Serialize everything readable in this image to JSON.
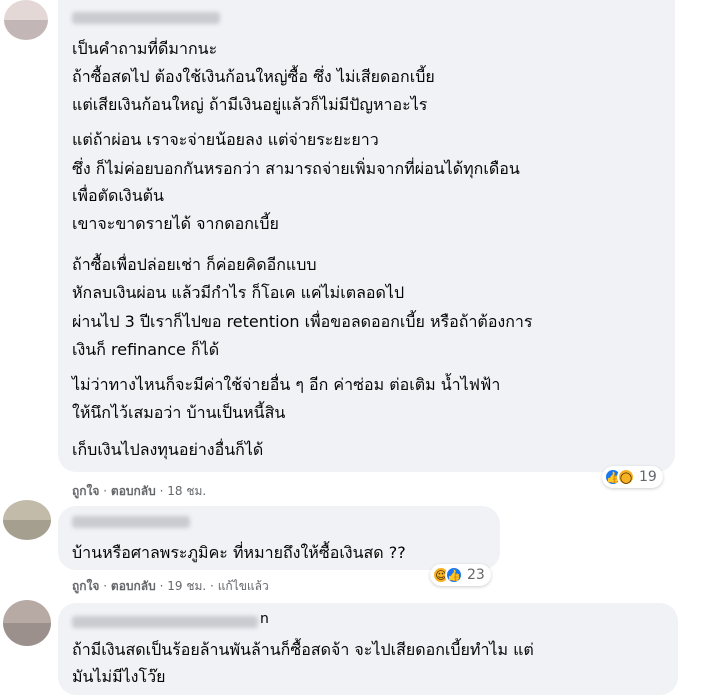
{
  "comments": [
    {
      "lines": [
        "เป็นคำถามที่ดีมากนะ",
        "ถ้าซื้อสดไป ต้องใช้เงินก้อนใหญ่ซื้อ ซึ่ง ไม่เสียดอกเบี้ย",
        "แต่เสียเงินก้อนใหญ่ ถ้ามีเงินอยู่แล้วก็ไม่มีปัญหาอะไร",
        "แต่ถ้าผ่อน เราจะจ่ายน้อยลง แต่จ่ายระยะยาว",
        "ซึ่ง ก็ไม่ค่อยบอกกันหรอกว่า สามารถจ่ายเพิ่มจากที่ผ่อนได้ทุกเดือน",
        "เพื่อตัดเงินต้น",
        "เขาจะขาดรายได้ จากดอกเบี้ย",
        "ถ้าซื้อเพื่อปล่อยเช่า ก็ค่อยคิดอีกแบบ",
        "หักลบเงินผ่อน แล้วมีกำไร ก็โอเค แค่ไม่เตลอดไป",
        "ผ่านไป 3 ปีเราก็ไปขอ retention เพื่อขอลดออกเบี้ย หรือถ้าต้องการ",
        "เงินก็ refinance ก็ได้",
        "ไม่ว่าทางไหนก็จะมีค่าใช้จ่ายอื่น ๆ อีก ค่าซ่อม ต่อเติม น้ำไฟฟ้า",
        "ให้นึกไว้เสมอว่า บ้านเป็นหนี้สิน",
        "เก็บเงินไปลงทุนอย่างอื่นก็ได้"
      ],
      "like_label": "ถูกใจ",
      "reply_label": "ตอบกลับ",
      "time": "18 ชม.",
      "edited": "",
      "reaction_count": "19",
      "reaction_icons": [
        "like-icon",
        "wow-icon"
      ]
    },
    {
      "lines": [
        "บ้านหรือศาลพระภูมิคะ ที่หมายถึงให้ซื้อเงินสด ??"
      ],
      "like_label": "ถูกใจ",
      "reply_label": "ตอบกลับ",
      "time": "19 ชม.",
      "edited": "แก้ไขแล้ว",
      "reaction_count": "23",
      "reaction_icons": [
        "haha-icon",
        "like-icon"
      ]
    },
    {
      "author_tail": "n",
      "lines": [
        "ถ้ามีเงินสดเป็นร้อยล้านพันล้านก็ซื้อสดจ้า จะไปเสียดอกเบี้ยทำไม แต่",
        "มันไม่มีไงโว๊ย"
      ]
    }
  ],
  "separator": "·",
  "colors": {
    "bubble": "#f0f2f5",
    "like": "#1877f2",
    "wow": "#f7b125",
    "meta": "#65676b"
  }
}
